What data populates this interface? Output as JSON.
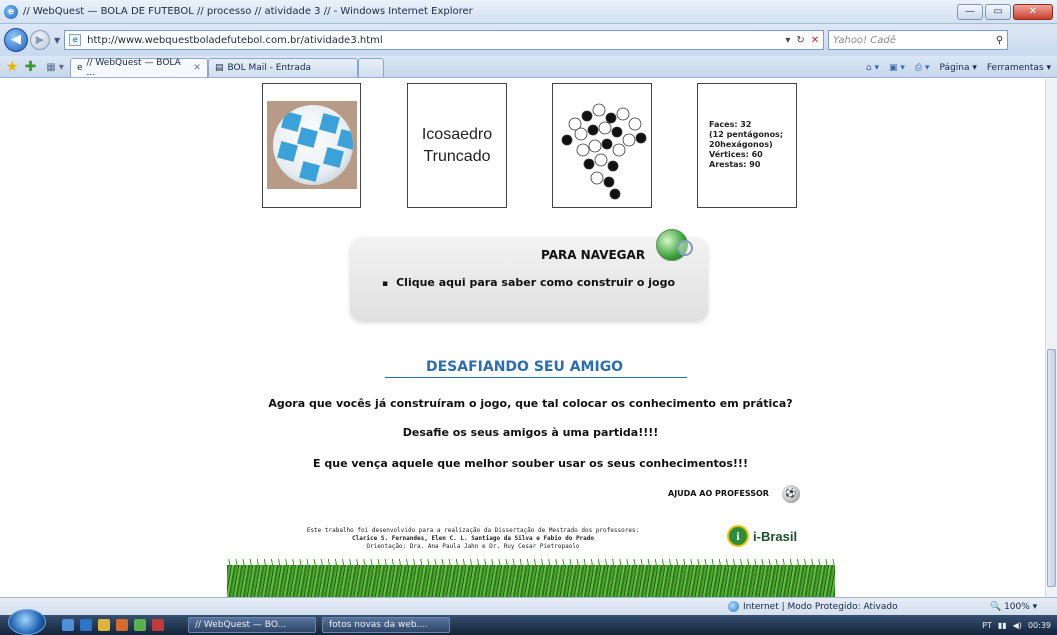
{
  "window": {
    "title": "// WebQuest — BOLA DE FUTEBOL // processo // atividade 3 // - Windows Internet Explorer",
    "buttons": {
      "minimize": "—",
      "maximize": "▭",
      "close": "✕"
    }
  },
  "address": {
    "url": "http://www.webquestboladefutebol.com.br/atividade3.html",
    "search_placeholder": "Yahoo! Cadê"
  },
  "tabs": [
    {
      "label": "// WebQuest — BOLA ...",
      "active": true
    },
    {
      "label": "BOL Mail - Entrada",
      "active": false
    }
  ],
  "commandbar": {
    "page": "Página",
    "tools": "Ferramentas"
  },
  "cards": {
    "name_line1": "Icosaedro",
    "name_line2": "Truncado",
    "stats": [
      "Faces: 32",
      "(12 pentágonos;",
      "20hexágonos)",
      "Vértices: 60",
      "Arestas: 90"
    ]
  },
  "nav": {
    "title": "PARA NAVEGAR",
    "link": "Clique aqui para saber como construir o jogo"
  },
  "challenge": {
    "title": "DESAFIANDO SEU AMIGO",
    "p1": "Agora que vocês já construíram o jogo, que tal colocar os conhecimento em prática?",
    "p2": "Desafie os seus amigos à uma partida!!!!",
    "p3": "E que vença aquele que melhor souber usar os seus conhecimentos!!!",
    "help": "AJUDA AO PROFESSOR"
  },
  "footer": {
    "line1": "Este trabalho foi desenvolvido para a realização da Dissertação de Mestrado dos professores:",
    "line2": "Clarice S. Fernandes, Elen C. L. Santiago da Silva e Fabio do Prado",
    "line3": "Orientação: Dra. Ana Paula Jahn e Dr. Ruy Cesar Pietropaolo",
    "brand": "i-Brasil",
    "brand_logo": "i"
  },
  "status": {
    "zone": "Internet | Modo Protegido: Ativado",
    "zoom": "100%"
  },
  "taskbar": {
    "task1": "// WebQuest — BO...",
    "task2": "fotos novas da web....",
    "lang": "PT",
    "clock": "00:39"
  },
  "colors": {
    "accent": "#2b6db5",
    "panel": "#3aa2d9"
  }
}
